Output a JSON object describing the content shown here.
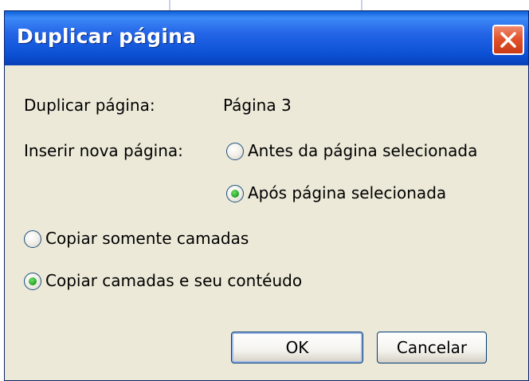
{
  "dialog": {
    "title": "Duplicar página",
    "close_icon": "close-icon"
  },
  "fields": {
    "duplicate_label": "Duplicar página:",
    "duplicate_value": "Página 3",
    "insert_label": "Inserir nova página:"
  },
  "insert_options": [
    {
      "label": "Antes da página selecionada",
      "selected": false
    },
    {
      "label": "Após página selecionada",
      "selected": true
    }
  ],
  "copy_options": [
    {
      "label": "Copiar somente camadas",
      "selected": false
    },
    {
      "label": "Copiar camadas e seu contéudo",
      "selected": true
    }
  ],
  "buttons": {
    "ok": "OK",
    "cancel": "Cancelar"
  },
  "colors": {
    "titlebar": "#0b50d4",
    "dialog_bg": "#ece9d8",
    "close_button": "#e2532d",
    "radio_selected": "#21a121"
  }
}
